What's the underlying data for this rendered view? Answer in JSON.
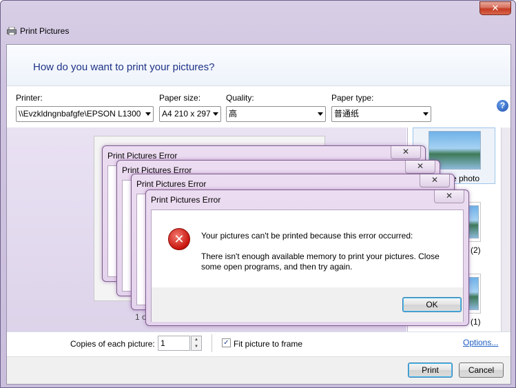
{
  "window": {
    "title": "Print Pictures",
    "close_glyph": "✕"
  },
  "header": {
    "heading": "How do you want to print your pictures?"
  },
  "fields": {
    "printer_label": "Printer:",
    "printer_value": "\\\\Evzkldngnbafgfe\\EPSON L1300",
    "paper_size_label": "Paper size:",
    "paper_size_value": "A4 210 x 297",
    "quality_label": "Quality:",
    "quality_value": "高",
    "paper_type_label": "Paper type:",
    "paper_type_value": "普通纸"
  },
  "preview": {
    "page_count_fragment": "1 o"
  },
  "layouts": [
    {
      "label": "e photo"
    },
    {
      "label": "(2)"
    },
    {
      "label": "(1)"
    }
  ],
  "bottom": {
    "copies_label": "Copies of each picture:",
    "copies_value": "1",
    "fit_label": "Fit picture to frame",
    "fit_checked_glyph": "✓",
    "options_link": "Options..."
  },
  "footer": {
    "print_label": "Print",
    "cancel_label": "Cancel"
  },
  "errors": {
    "title": "Print Pictures Error",
    "close_glyph": "✕",
    "line1": "Your pictures can't be printed because this error occurred:",
    "line2": "There isn't enough available memory to print your pictures.  Close some open programs, and then try again.",
    "ok_label": "OK",
    "icon_glyph": "✕"
  },
  "help_glyph": "?"
}
